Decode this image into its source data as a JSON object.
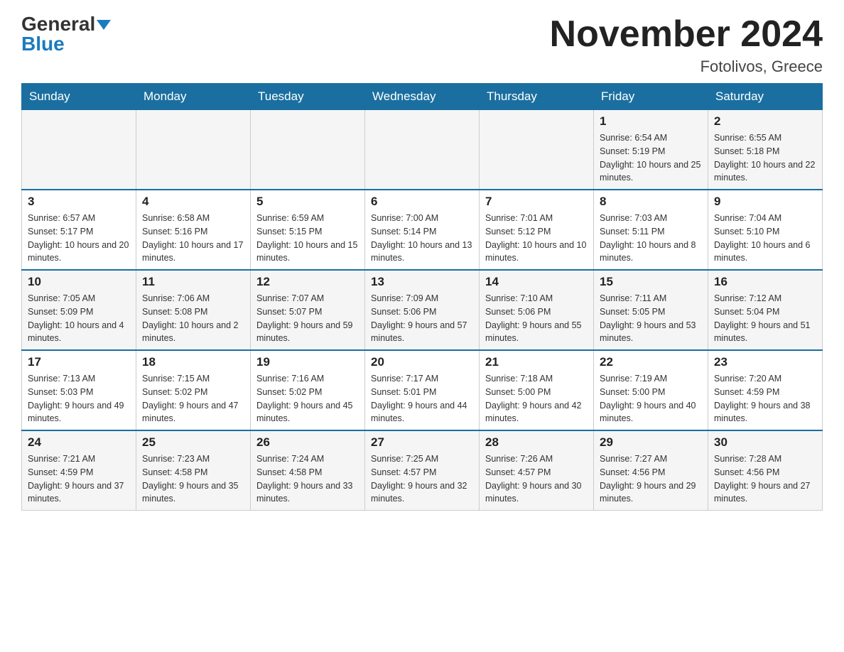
{
  "header": {
    "logo_general": "General",
    "logo_blue": "Blue",
    "month_title": "November 2024",
    "location": "Fotolivos, Greece"
  },
  "weekdays": [
    "Sunday",
    "Monday",
    "Tuesday",
    "Wednesday",
    "Thursday",
    "Friday",
    "Saturday"
  ],
  "weeks": [
    [
      {
        "day": "",
        "sunrise": "",
        "sunset": "",
        "daylight": ""
      },
      {
        "day": "",
        "sunrise": "",
        "sunset": "",
        "daylight": ""
      },
      {
        "day": "",
        "sunrise": "",
        "sunset": "",
        "daylight": ""
      },
      {
        "day": "",
        "sunrise": "",
        "sunset": "",
        "daylight": ""
      },
      {
        "day": "",
        "sunrise": "",
        "sunset": "",
        "daylight": ""
      },
      {
        "day": "1",
        "sunrise": "Sunrise: 6:54 AM",
        "sunset": "Sunset: 5:19 PM",
        "daylight": "Daylight: 10 hours and 25 minutes."
      },
      {
        "day": "2",
        "sunrise": "Sunrise: 6:55 AM",
        "sunset": "Sunset: 5:18 PM",
        "daylight": "Daylight: 10 hours and 22 minutes."
      }
    ],
    [
      {
        "day": "3",
        "sunrise": "Sunrise: 6:57 AM",
        "sunset": "Sunset: 5:17 PM",
        "daylight": "Daylight: 10 hours and 20 minutes."
      },
      {
        "day": "4",
        "sunrise": "Sunrise: 6:58 AM",
        "sunset": "Sunset: 5:16 PM",
        "daylight": "Daylight: 10 hours and 17 minutes."
      },
      {
        "day": "5",
        "sunrise": "Sunrise: 6:59 AM",
        "sunset": "Sunset: 5:15 PM",
        "daylight": "Daylight: 10 hours and 15 minutes."
      },
      {
        "day": "6",
        "sunrise": "Sunrise: 7:00 AM",
        "sunset": "Sunset: 5:14 PM",
        "daylight": "Daylight: 10 hours and 13 minutes."
      },
      {
        "day": "7",
        "sunrise": "Sunrise: 7:01 AM",
        "sunset": "Sunset: 5:12 PM",
        "daylight": "Daylight: 10 hours and 10 minutes."
      },
      {
        "day": "8",
        "sunrise": "Sunrise: 7:03 AM",
        "sunset": "Sunset: 5:11 PM",
        "daylight": "Daylight: 10 hours and 8 minutes."
      },
      {
        "day": "9",
        "sunrise": "Sunrise: 7:04 AM",
        "sunset": "Sunset: 5:10 PM",
        "daylight": "Daylight: 10 hours and 6 minutes."
      }
    ],
    [
      {
        "day": "10",
        "sunrise": "Sunrise: 7:05 AM",
        "sunset": "Sunset: 5:09 PM",
        "daylight": "Daylight: 10 hours and 4 minutes."
      },
      {
        "day": "11",
        "sunrise": "Sunrise: 7:06 AM",
        "sunset": "Sunset: 5:08 PM",
        "daylight": "Daylight: 10 hours and 2 minutes."
      },
      {
        "day": "12",
        "sunrise": "Sunrise: 7:07 AM",
        "sunset": "Sunset: 5:07 PM",
        "daylight": "Daylight: 9 hours and 59 minutes."
      },
      {
        "day": "13",
        "sunrise": "Sunrise: 7:09 AM",
        "sunset": "Sunset: 5:06 PM",
        "daylight": "Daylight: 9 hours and 57 minutes."
      },
      {
        "day": "14",
        "sunrise": "Sunrise: 7:10 AM",
        "sunset": "Sunset: 5:06 PM",
        "daylight": "Daylight: 9 hours and 55 minutes."
      },
      {
        "day": "15",
        "sunrise": "Sunrise: 7:11 AM",
        "sunset": "Sunset: 5:05 PM",
        "daylight": "Daylight: 9 hours and 53 minutes."
      },
      {
        "day": "16",
        "sunrise": "Sunrise: 7:12 AM",
        "sunset": "Sunset: 5:04 PM",
        "daylight": "Daylight: 9 hours and 51 minutes."
      }
    ],
    [
      {
        "day": "17",
        "sunrise": "Sunrise: 7:13 AM",
        "sunset": "Sunset: 5:03 PM",
        "daylight": "Daylight: 9 hours and 49 minutes."
      },
      {
        "day": "18",
        "sunrise": "Sunrise: 7:15 AM",
        "sunset": "Sunset: 5:02 PM",
        "daylight": "Daylight: 9 hours and 47 minutes."
      },
      {
        "day": "19",
        "sunrise": "Sunrise: 7:16 AM",
        "sunset": "Sunset: 5:02 PM",
        "daylight": "Daylight: 9 hours and 45 minutes."
      },
      {
        "day": "20",
        "sunrise": "Sunrise: 7:17 AM",
        "sunset": "Sunset: 5:01 PM",
        "daylight": "Daylight: 9 hours and 44 minutes."
      },
      {
        "day": "21",
        "sunrise": "Sunrise: 7:18 AM",
        "sunset": "Sunset: 5:00 PM",
        "daylight": "Daylight: 9 hours and 42 minutes."
      },
      {
        "day": "22",
        "sunrise": "Sunrise: 7:19 AM",
        "sunset": "Sunset: 5:00 PM",
        "daylight": "Daylight: 9 hours and 40 minutes."
      },
      {
        "day": "23",
        "sunrise": "Sunrise: 7:20 AM",
        "sunset": "Sunset: 4:59 PM",
        "daylight": "Daylight: 9 hours and 38 minutes."
      }
    ],
    [
      {
        "day": "24",
        "sunrise": "Sunrise: 7:21 AM",
        "sunset": "Sunset: 4:59 PM",
        "daylight": "Daylight: 9 hours and 37 minutes."
      },
      {
        "day": "25",
        "sunrise": "Sunrise: 7:23 AM",
        "sunset": "Sunset: 4:58 PM",
        "daylight": "Daylight: 9 hours and 35 minutes."
      },
      {
        "day": "26",
        "sunrise": "Sunrise: 7:24 AM",
        "sunset": "Sunset: 4:58 PM",
        "daylight": "Daylight: 9 hours and 33 minutes."
      },
      {
        "day": "27",
        "sunrise": "Sunrise: 7:25 AM",
        "sunset": "Sunset: 4:57 PM",
        "daylight": "Daylight: 9 hours and 32 minutes."
      },
      {
        "day": "28",
        "sunrise": "Sunrise: 7:26 AM",
        "sunset": "Sunset: 4:57 PM",
        "daylight": "Daylight: 9 hours and 30 minutes."
      },
      {
        "day": "29",
        "sunrise": "Sunrise: 7:27 AM",
        "sunset": "Sunset: 4:56 PM",
        "daylight": "Daylight: 9 hours and 29 minutes."
      },
      {
        "day": "30",
        "sunrise": "Sunrise: 7:28 AM",
        "sunset": "Sunset: 4:56 PM",
        "daylight": "Daylight: 9 hours and 27 minutes."
      }
    ]
  ]
}
